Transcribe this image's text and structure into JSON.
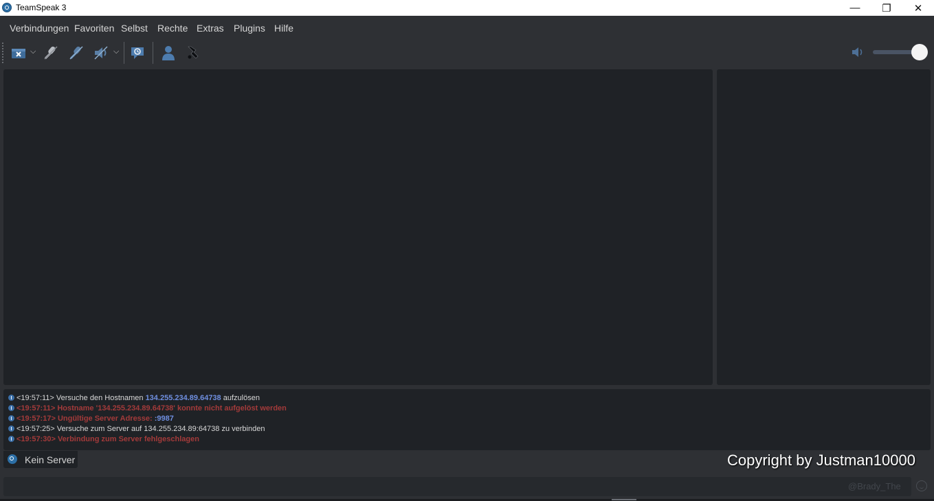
{
  "window": {
    "title": "TeamSpeak 3",
    "minimize": "—",
    "maximize": "❐",
    "close": "✕"
  },
  "menu": [
    "Verbindungen",
    "Favoriten",
    "Selbst",
    "Rechte",
    "Extras",
    "Plugins",
    "Hilfe"
  ],
  "toolbar": {
    "icons": [
      "disconnect-icon",
      "mute-microphone-icon",
      "mute-microphone-alt-icon",
      "speaker-icon",
      "away-status-icon",
      "contacts-icon",
      "plugin-icon"
    ],
    "volume_level": 0.85
  },
  "log": [
    {
      "time": "<19:57:11>",
      "before": "Versuche den Hostnamen ",
      "highlight": "134.255.234.89.64738",
      "after": " aufzulösen",
      "error": false
    },
    {
      "time": "<19:57:11>",
      "before": "Hostname '134.255.234.89.64738' konnte nicht aufgelöst werden",
      "highlight": "",
      "after": "",
      "error": true
    },
    {
      "time": "<19:57:17>",
      "before": "Ungültige Server Adresse: ",
      "highlight": ":9987",
      "after": "",
      "error": true
    },
    {
      "time": "<19:57:25>",
      "before": "Versuche zum Server auf 134.255.234.89:64738 zu verbinden",
      "highlight": "",
      "after": "",
      "error": false
    },
    {
      "time": "<19:57:30>",
      "before": "Verbindung zum Server fehlgeschlagen",
      "highlight": "",
      "after": "",
      "error": true
    }
  ],
  "server_tab": {
    "label": "Kein Server"
  },
  "overlay": {
    "copyright": "Copyright by Justman10000"
  },
  "chat": {
    "watermark": "@Brady_The"
  },
  "colors": {
    "background": "#2e3034",
    "panel": "#1f2226",
    "link": "#6f8fe0",
    "error": "#a33a3a"
  }
}
